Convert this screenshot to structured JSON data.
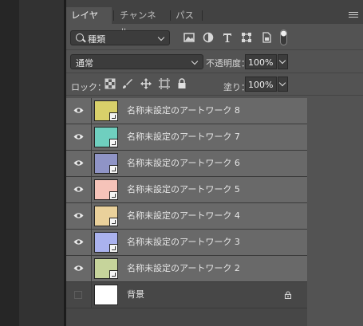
{
  "tabs": [
    {
      "label": "レイヤー",
      "active": true
    },
    {
      "label": "チャンネル",
      "active": false
    },
    {
      "label": "パス",
      "active": false
    }
  ],
  "filter": {
    "kind_label": "種類",
    "icons": [
      "pixel-filter-icon",
      "adjustment-filter-icon",
      "type-filter-icon",
      "shape-filter-icon",
      "smart-object-filter-icon",
      "filter-toggle-icon"
    ]
  },
  "blend": {
    "mode": "通常",
    "opacity_label": "不透明度：",
    "opacity_value": "100%"
  },
  "lock": {
    "label": "ロック：",
    "fill_label": "塗り：",
    "fill_value": "100%",
    "icons": [
      "lock-transparency-icon",
      "lock-image-icon",
      "lock-position-icon",
      "artboard-icon",
      "lock-all-icon"
    ]
  },
  "layers": [
    {
      "name": "名称未設定のアートワーク 8",
      "visible": true,
      "selected": true,
      "thumb": "#d8d06a"
    },
    {
      "name": "名称未設定のアートワーク 7",
      "visible": true,
      "selected": true,
      "thumb": "#6fcfbf"
    },
    {
      "name": "名称未設定のアートワーク 6",
      "visible": true,
      "selected": true,
      "thumb": "#8f94c6"
    },
    {
      "name": "名称未設定のアートワーク 5",
      "visible": true,
      "selected": true,
      "thumb": "#f6c3b9"
    },
    {
      "name": "名称未設定のアートワーク 4",
      "visible": true,
      "selected": true,
      "thumb": "#ead19b"
    },
    {
      "name": "名称未設定のアートワーク 3",
      "visible": true,
      "selected": true,
      "thumb": "#aab2ee"
    },
    {
      "name": "名称未設定のアートワーク 2",
      "visible": true,
      "selected": true,
      "thumb": "#c6d49b"
    },
    {
      "name": "背景",
      "visible": false,
      "selected": false,
      "thumb": "#ffffff",
      "locked": true
    }
  ],
  "colors": {
    "panel": "#535353",
    "selected_row": "#696969",
    "list_bg": "#474747"
  }
}
